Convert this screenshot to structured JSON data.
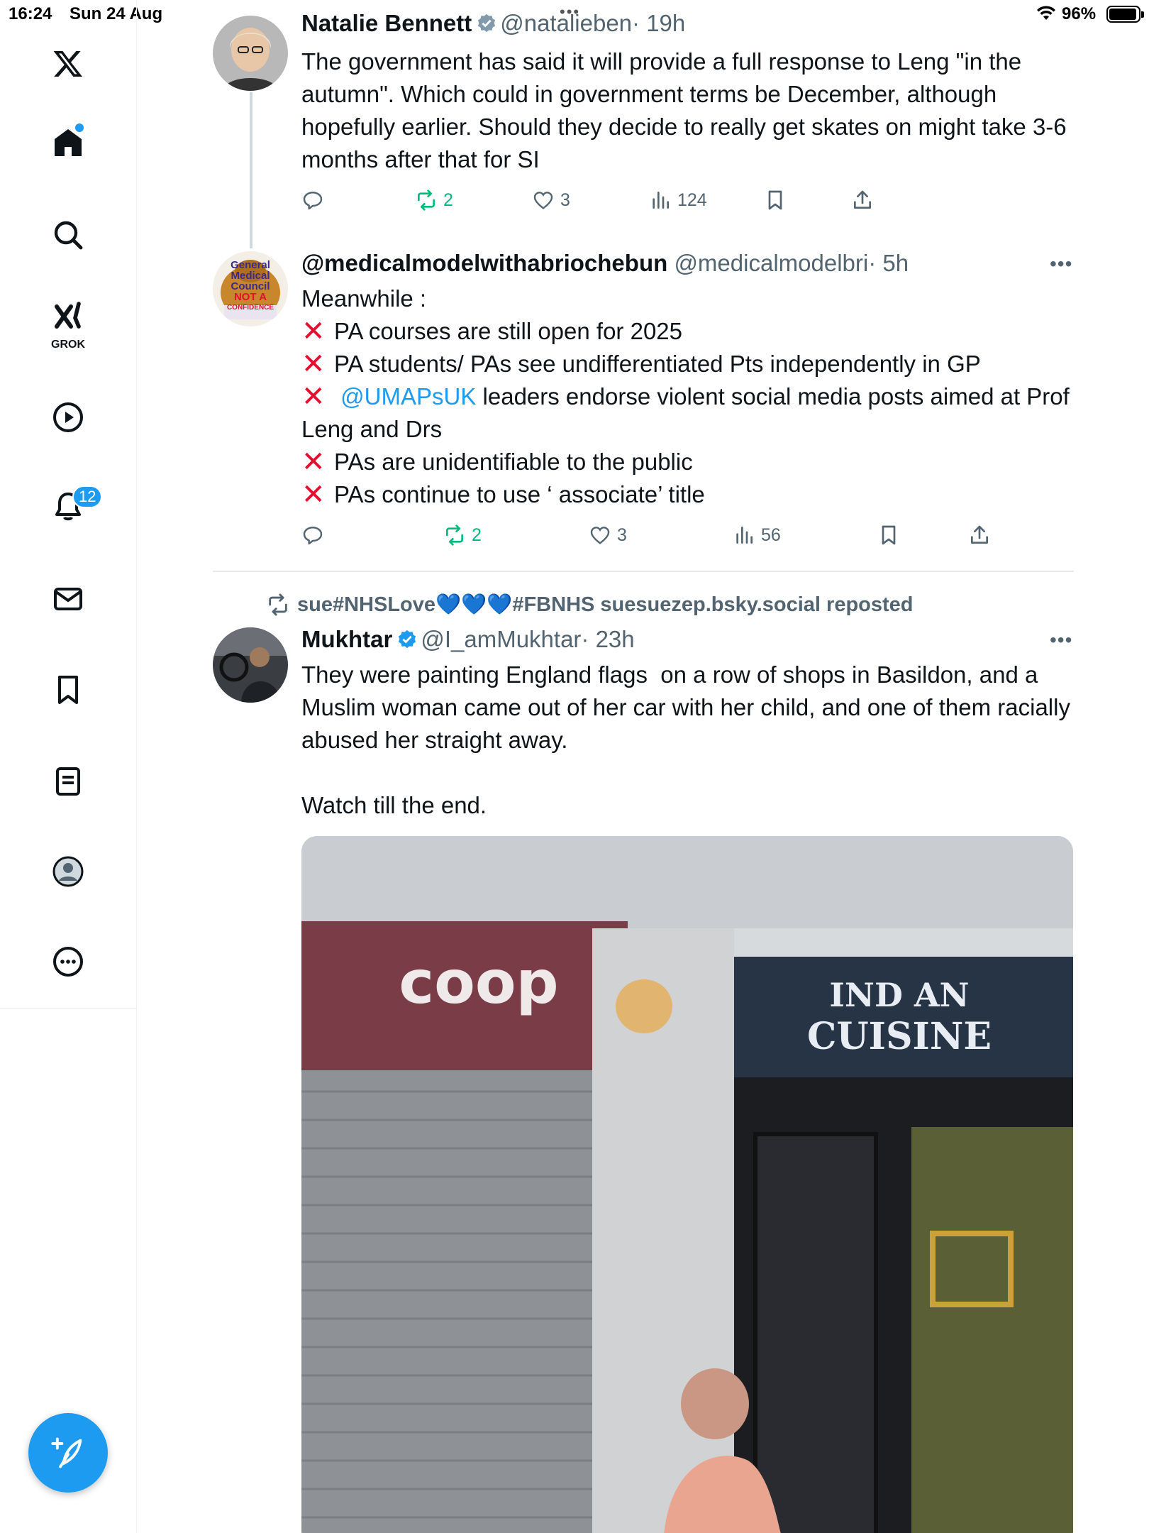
{
  "status_bar": {
    "time": "16:24",
    "date": "Sun 24 Aug",
    "battery_percent": "96%",
    "battery_level": 0.96
  },
  "sidebar": {
    "items": [
      {
        "icon": "x-logo-icon"
      },
      {
        "icon": "home-icon",
        "has_dot": true
      },
      {
        "icon": "search-icon"
      },
      {
        "icon": "grok-icon",
        "label": "GROK"
      },
      {
        "icon": "video-icon"
      },
      {
        "icon": "notifications-icon",
        "badge": "12"
      },
      {
        "icon": "messages-icon"
      },
      {
        "icon": "bookmarks-icon"
      },
      {
        "icon": "lists-icon"
      },
      {
        "icon": "profile-icon"
      },
      {
        "icon": "more-icon"
      }
    ],
    "compose_icon": "compose-post-icon"
  },
  "tweets": [
    {
      "name": "Natalie Bennett",
      "verified": true,
      "handle": "@natalieben",
      "time": "· 19h",
      "text": "The government has said it will provide a full response to Leng \"in the autumn\". Which could in government terms be December, although hopefully earlier. Should they decide to really get skates on might take 3-6 months after that for SI",
      "replies": "",
      "reposts": "2",
      "likes": "3",
      "views": "124"
    },
    {
      "name": "@medicalmodelwithabriochebun",
      "verified": false,
      "handle": "@medicalmodelbri",
      "time": "· 5h",
      "avatar_text": [
        "General",
        "Medical",
        "Council",
        "NOT A",
        "CONFIDENCE"
      ],
      "text_intro": "Meanwhile :",
      "bullets": [
        "PA courses are still open for 2025",
        "PA students/ PAs see undifferentiated Pts independently in GP",
        "PAs are unidentifiable to the public",
        "PAs continue to use ‘ associate’ title"
      ],
      "mention": "@UMAPsUK",
      "mention_rest": " leaders endorse violent social media posts aimed at Prof Leng and Drs",
      "replies": "",
      "reposts": "2",
      "likes": "3",
      "views": "56"
    },
    {
      "reposted_by": "sue#NHSLove💙💙💙#FBNHS suesuezep.bsky.social reposted",
      "name": "Mukhtar",
      "verified": true,
      "handle": "@I_amMukhtar",
      "time": "· 23h",
      "text": "They were painting England flags  on a row of shops in Basildon, and a Muslim woman came out of her car with her child, and one of them racially abused her straight away.\n\nWatch till the end.",
      "media": {
        "sign_left": "coop",
        "sign_right_1": "IND  AN",
        "sign_right_2": "CUISINE"
      }
    }
  ],
  "colors": {
    "accent": "#1d9bf0",
    "repost_green": "#00ba7c",
    "muted": "#536471",
    "cross_red": "#e0102e"
  }
}
